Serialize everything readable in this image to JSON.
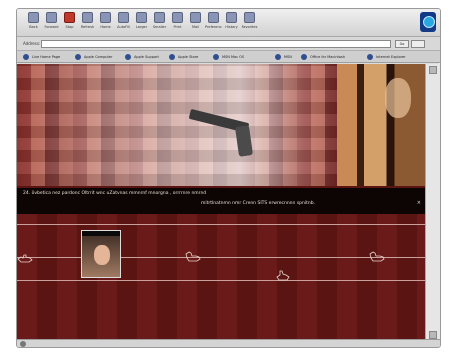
{
  "toolbar": {
    "buttons": [
      "Back",
      "Forward",
      "Stop",
      "Refresh",
      "Home",
      "AutoFill",
      "Larger",
      "Smaller",
      "Print",
      "Mail",
      "Preferences",
      "History",
      "Favorites"
    ]
  },
  "address": {
    "label": "Address:",
    "value": "",
    "go_label": "Go"
  },
  "favorites": [
    "Live Home Page",
    "Apple Computer",
    "Apple Support",
    "Apple Store",
    "MSN Mac OS",
    "MSN",
    "Office for Macintosh",
    "Internet Explorer"
  ],
  "marquee": {
    "line1": "24. övbetica nez pardonc Oltrrit wnc uZatvnas mmnrnf mnorgna , orrrrnre nmrnd",
    "line2": "mitrtlnatnmn nmr Crenn  SITS erwrecnnnn spnitnb.",
    "close": "×"
  },
  "status": {
    "text": ""
  },
  "colors": {
    "page_bg": "#5a1412",
    "marquee_bg": "#0d0504",
    "chrome": "#dcdcdc",
    "throbber": "#123a86"
  }
}
